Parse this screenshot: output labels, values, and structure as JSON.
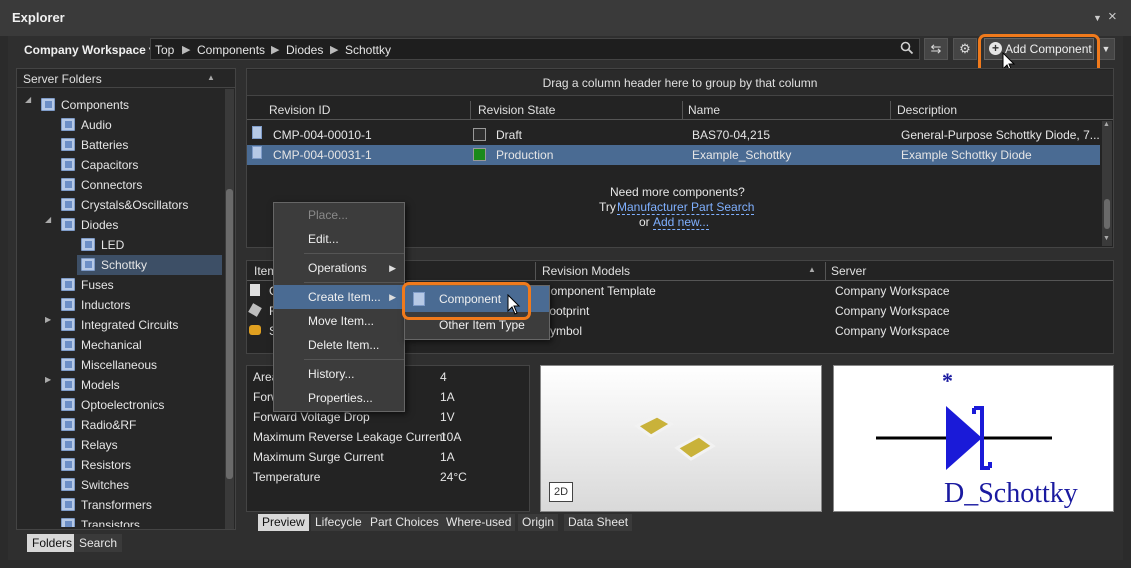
{
  "window": {
    "title": "Explorer",
    "pin_glyph": "▼",
    "close_glyph": "×"
  },
  "toolbar": {
    "workspace": "Company Workspace ▾",
    "breadcrumbs": [
      "Top",
      "Components",
      "Diodes",
      "Schottky"
    ],
    "add_component": "Add Component"
  },
  "folders": {
    "title": "Server Folders",
    "items": [
      {
        "label": "Components",
        "level": 1,
        "expander": "◢"
      },
      {
        "label": "Audio",
        "level": 2
      },
      {
        "label": "Batteries",
        "level": 2
      },
      {
        "label": "Capacitors",
        "level": 2
      },
      {
        "label": "Connectors",
        "level": 2
      },
      {
        "label": "Crystals&Oscillators",
        "level": 2
      },
      {
        "label": "Diodes",
        "level": 2,
        "expander": "◢"
      },
      {
        "label": "LED",
        "level": 3
      },
      {
        "label": "Schottky",
        "level": 3,
        "selected": true
      },
      {
        "label": "Fuses",
        "level": 2
      },
      {
        "label": "Inductors",
        "level": 2
      },
      {
        "label": "Integrated Circuits",
        "level": 2,
        "expander": "▶"
      },
      {
        "label": "Mechanical",
        "level": 2
      },
      {
        "label": "Miscellaneous",
        "level": 2
      },
      {
        "label": "Models",
        "level": 2,
        "expander": "▶"
      },
      {
        "label": "Optoelectronics",
        "level": 2
      },
      {
        "label": "Radio&RF",
        "level": 2
      },
      {
        "label": "Relays",
        "level": 2
      },
      {
        "label": "Resistors",
        "level": 2
      },
      {
        "label": "Switches",
        "level": 2
      },
      {
        "label": "Transformers",
        "level": 2
      },
      {
        "label": "Transistors",
        "level": 2
      }
    ],
    "tabs": [
      "Folders",
      "Search"
    ]
  },
  "grid": {
    "group_hint": "Drag a column header here to group by that column",
    "columns": [
      "Revision ID",
      "Revision State",
      "Name",
      "Description"
    ],
    "rows": [
      {
        "id": "CMP-004-00010-1",
        "state": "Draft",
        "state_color": "#2e2e2e",
        "name": "BAS70-04,215",
        "desc": "General-Purpose Schottky Diode, 7..."
      },
      {
        "id": "CMP-004-00031-1",
        "state": "Production",
        "state_color": "#1a8a1a",
        "name": "Example_Schottky",
        "desc": "Example Schottky Diode",
        "selected": true
      }
    ],
    "more_title": "Need more components?",
    "more_try": "Try",
    "more_link": "Manufacturer Part Search",
    "more_or": "or",
    "more_add": "Add new..."
  },
  "models": {
    "columns": [
      "Item",
      "Revision Models",
      "Server"
    ],
    "rows": [
      {
        "item": "C",
        "model": "Component Template",
        "server": "Company Workspace"
      },
      {
        "item": "F",
        "model": "Footprint",
        "server": "Company Workspace"
      },
      {
        "item": "S",
        "model": "Symbol",
        "server": "Company Workspace"
      }
    ]
  },
  "params": {
    "rows": [
      {
        "name": "Area",
        "value": "4"
      },
      {
        "name": "Forward Current",
        "value": "1A"
      },
      {
        "name": "Forward Voltage Drop",
        "value": "1V"
      },
      {
        "name": "Maximum Reverse Leakage Current",
        "value": "10A"
      },
      {
        "name": "Maximum Surge Current",
        "value": "1A"
      },
      {
        "name": "Temperature",
        "value": "24°C"
      }
    ]
  },
  "preview": {
    "mode_2d": "2D",
    "symbol_star": "*",
    "symbol_name": "D_Schottky",
    "tabs": [
      "Preview",
      "Lifecycle",
      "Part Choices",
      "Where-used",
      "Origin",
      "Data Sheet"
    ]
  },
  "context_menu": {
    "items": [
      {
        "label": "Place...",
        "disabled": true
      },
      {
        "label": "Edit..."
      },
      {
        "sep": true
      },
      {
        "label": "Operations",
        "submenu": true
      },
      {
        "sep": true
      },
      {
        "label": "Create Item...",
        "submenu": true,
        "active": true
      },
      {
        "label": "Move Item..."
      },
      {
        "label": "Delete Item..."
      },
      {
        "sep": true
      },
      {
        "label": "History..."
      },
      {
        "label": "Properties..."
      }
    ],
    "submenu": [
      "Component",
      "Other Item Type"
    ]
  },
  "colors": {
    "highlight": "#f07a1c",
    "selection": "#4a6b93",
    "link": "#7fb0ff"
  }
}
